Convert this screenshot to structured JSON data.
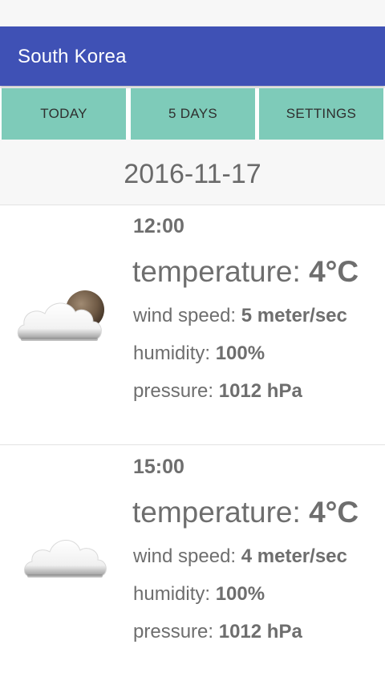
{
  "app": {
    "title": "South Korea"
  },
  "tabs": [
    {
      "label": "TODAY"
    },
    {
      "label": "5 DAYS"
    },
    {
      "label": "SETTINGS"
    }
  ],
  "date": "2016-11-17",
  "labels": {
    "temperature": "temperature: ",
    "wind": "wind speed: ",
    "humidity": "humidity: ",
    "pressure": "pressure: "
  },
  "forecasts": [
    {
      "time": "12:00",
      "icon": "cloud-with-dark-moon-icon",
      "temperature": "4°C",
      "wind": "5 meter/sec",
      "humidity": "100%",
      "pressure": "1012 hPa"
    },
    {
      "time": "15:00",
      "icon": "cloud-icon",
      "temperature": "4°C",
      "wind": "4 meter/sec",
      "humidity": "100%",
      "pressure": "1012 hPa"
    }
  ]
}
